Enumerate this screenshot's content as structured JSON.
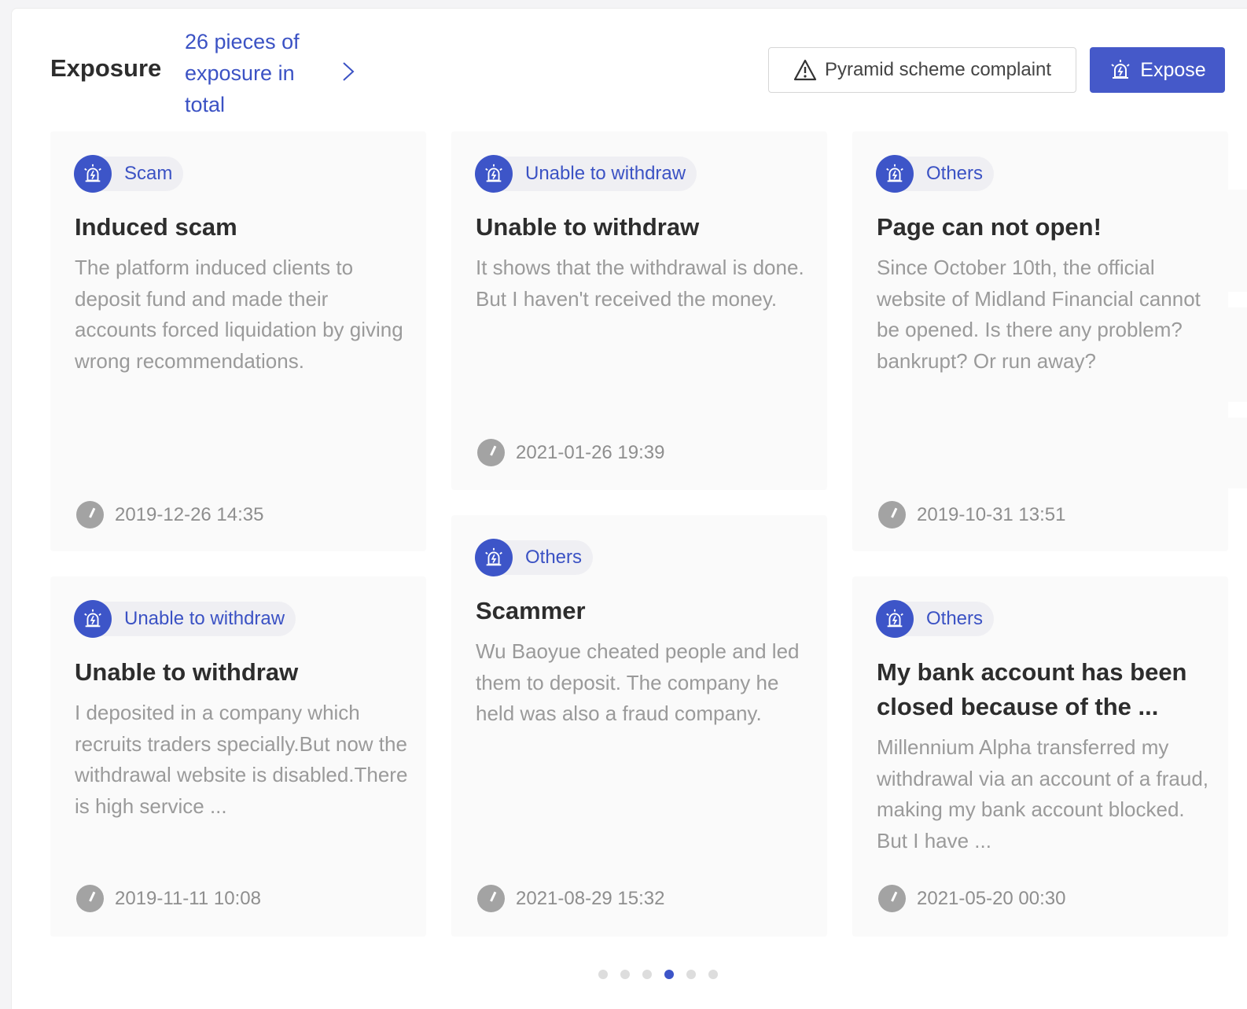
{
  "header": {
    "title": "Exposure",
    "count_text": "26 pieces of exposure in total",
    "complaint_label": "Pyramid scheme complaint",
    "expose_label": "Expose"
  },
  "cards": [
    {
      "tag": "Scam",
      "title": "Induced scam",
      "text": "The platform induced clients to deposit fund and made their accounts forced liquidation by giving wrong recommendations.",
      "date": "2019-12-26 14:35"
    },
    {
      "tag": "Unable to withdraw",
      "title": "Unable to withdraw",
      "text": "It shows that the withdrawal is done. But I haven't received the money.",
      "date": "2021-01-26 19:39"
    },
    {
      "tag": "Others",
      "title": "Page can not open!",
      "text": "Since October 10th, the official website of Midland Financial cannot be opened. Is there any problem? bankrupt? Or run away?",
      "date": "2019-10-31 13:51"
    },
    {
      "tag": "Unable to withdraw",
      "title": "Unable to withdraw",
      "text": "I deposited in a company which recruits traders specially.But now the withdrawal website is disabled.There is high service ...",
      "date": "2019-11-11 10:08"
    },
    {
      "tag": "Others",
      "title": "Scammer",
      "text": "Wu Baoyue cheated people and led them to deposit. The company he held was also a fraud company.",
      "date": "2021-08-29 15:32"
    },
    {
      "tag": "Others",
      "title": "My bank account has been closed because of the ...",
      "text": "Millennium Alpha transferred my withdrawal via an account of a fraud, making my bank account blocked. But I have ...",
      "date": "2021-05-20 00:30"
    }
  ],
  "pagination": {
    "total_pages": 6,
    "current_page": 4
  },
  "colors": {
    "accent": "#3d55c8",
    "link": "#3b52c4",
    "muted_text": "#9a9a9a"
  }
}
